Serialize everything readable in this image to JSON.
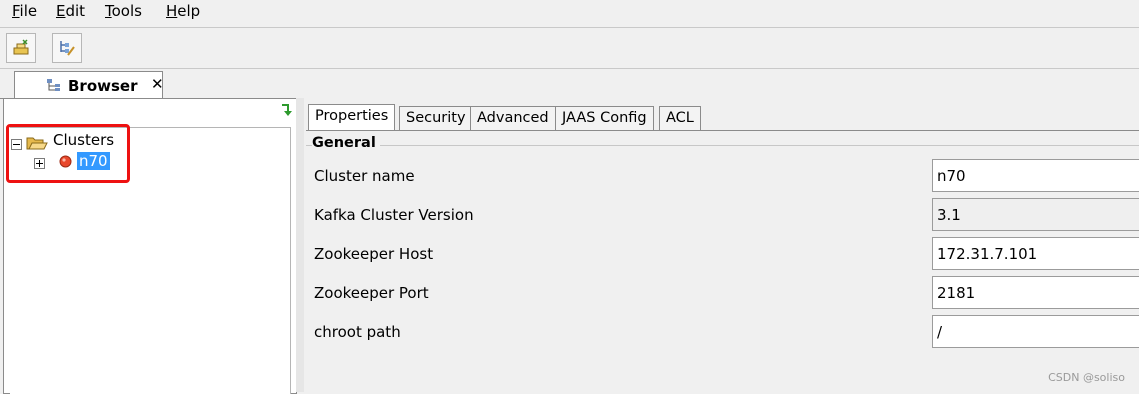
{
  "menubar": {
    "file": {
      "mnemonic": "F",
      "rest": "ile"
    },
    "edit": {
      "mnemonic": "E",
      "rest": "dit"
    },
    "tools": {
      "mnemonic": "T",
      "rest": "ools"
    },
    "help": {
      "mnemonic": "H",
      "rest": "elp"
    }
  },
  "toolbar": {
    "buttons": [
      {
        "icon": "add-cluster-icon"
      },
      {
        "icon": "edit-tree-icon"
      }
    ]
  },
  "main_tab": {
    "label": "Browser",
    "close": "✕",
    "icon": "tree-structure-icon"
  },
  "tree": {
    "root": {
      "label": "Clusters",
      "expanded": true,
      "icon": "folder-open-icon"
    },
    "children": [
      {
        "label": "n70",
        "selected": true,
        "status_icon": "red-status-dot-icon",
        "expanded": false
      }
    ]
  },
  "property_tabs": [
    "Properties",
    "Security",
    "Advanced",
    "JAAS Config",
    "ACL"
  ],
  "active_tab": "Properties",
  "general": {
    "title": "General",
    "fields": [
      {
        "label": "Cluster name",
        "value": "n70"
      },
      {
        "label": "Kafka Cluster Version",
        "value": "3.1"
      },
      {
        "label": "Zookeeper Host",
        "value": "172.31.7.101"
      },
      {
        "label": "Zookeeper Port",
        "value": "2181"
      },
      {
        "label": "chroot path",
        "value": "/"
      }
    ]
  },
  "watermark": "CSDN @soliso",
  "colors": {
    "selection": "#3399ff",
    "highlight_box": "#ee1111"
  }
}
